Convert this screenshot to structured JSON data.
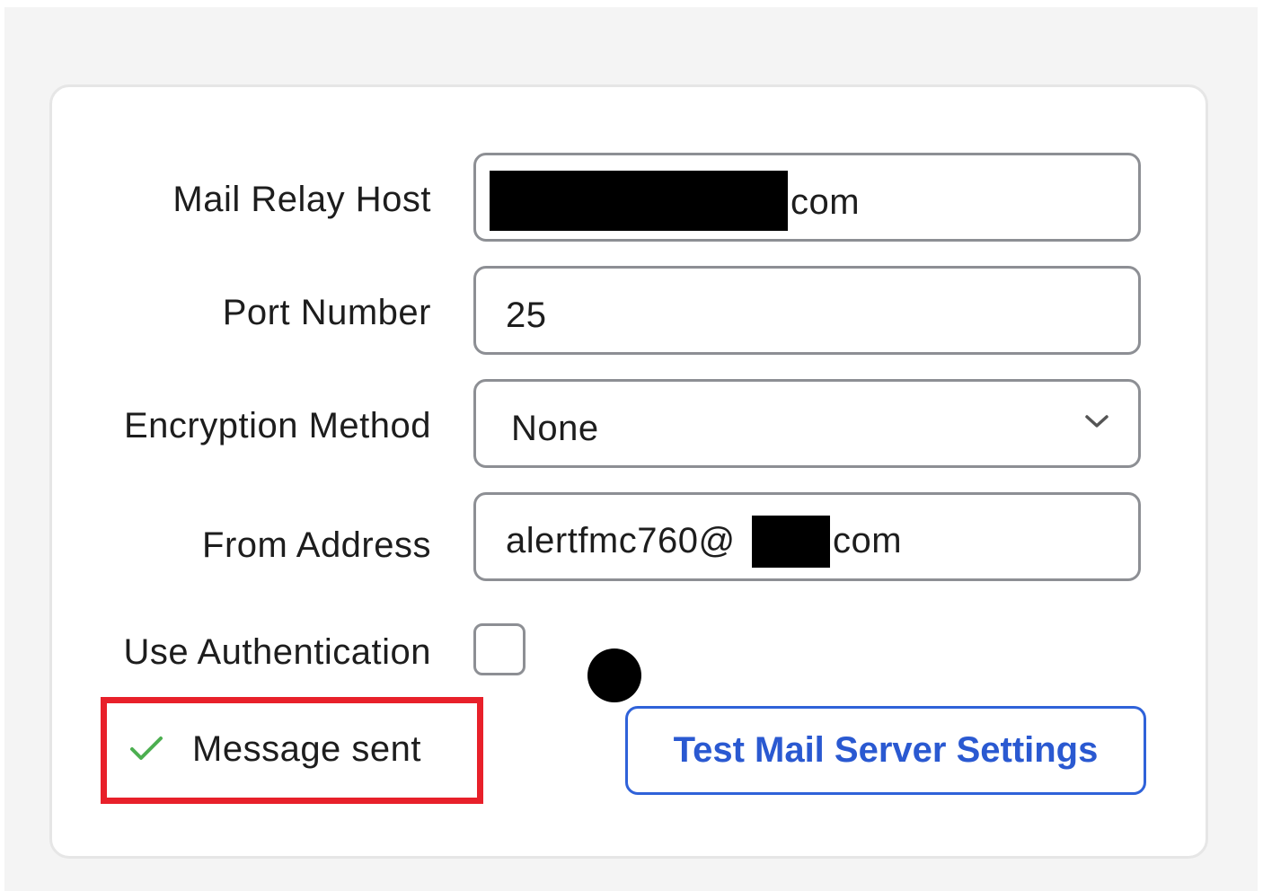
{
  "form": {
    "mail_relay_host": {
      "label": "Mail Relay Host",
      "value_suffix": "com"
    },
    "port_number": {
      "label": "Port Number",
      "value": "25"
    },
    "encryption_method": {
      "label": "Encryption Method",
      "selected": "None"
    },
    "from_address": {
      "label": "From Address",
      "value_prefix": "alertfmc760@",
      "value_suffix": "com"
    },
    "use_authentication": {
      "label": "Use Authentication",
      "checked": false
    }
  },
  "status": {
    "icon": "checkmark-icon",
    "text": "Message sent",
    "color": "#4caf50"
  },
  "actions": {
    "test_button_label": "Test Mail Server Settings"
  },
  "colors": {
    "accent": "#2a59d1",
    "highlight": "#e8202a",
    "field_border": "#8d8f94"
  }
}
